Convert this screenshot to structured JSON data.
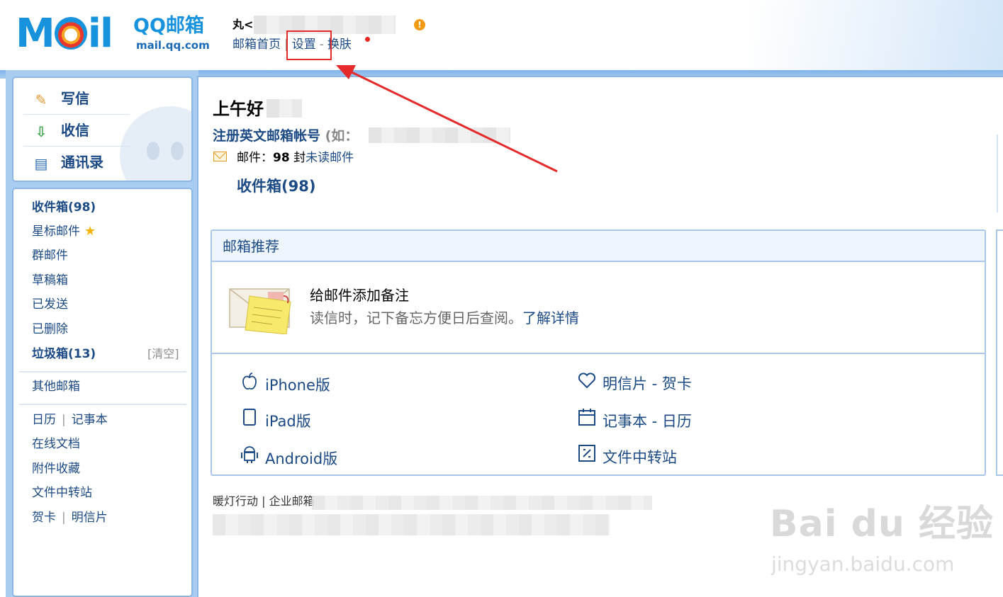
{
  "header": {
    "logo_text": "M",
    "logo_text2": "il",
    "logo_brand": "QQ邮箱",
    "logo_url": "mail.qq.com",
    "user_name_prefix": "丸<",
    "warning_glyph": "!",
    "links": {
      "home": "邮箱首页",
      "settings": "设置",
      "skin": "换肤",
      "sep_bar": "|",
      "sep_dash": "-"
    }
  },
  "quick_actions": [
    {
      "label": "写信",
      "icon": "pencil-icon",
      "glyph": "✎"
    },
    {
      "label": "收信",
      "icon": "inbox-download-icon",
      "glyph": "⇩"
    },
    {
      "label": "通讯录",
      "icon": "contacts-card-icon",
      "glyph": "▤"
    }
  ],
  "nav": {
    "inbox": "收件箱(98)",
    "starred": "星标邮件",
    "star_glyph": "★",
    "group": "群邮件",
    "drafts": "草稿箱",
    "sent": "已发送",
    "deleted": "已删除",
    "spam": "垃圾箱(13)",
    "spam_clear": "[清空]",
    "other": "其他邮箱",
    "calendar": "日历",
    "notebook": "记事本",
    "docs": "在线文档",
    "attachments": "附件收藏",
    "file_transfer": "文件中转站",
    "greeting_card": "贺卡",
    "postcard": "明信片",
    "pipe": "|"
  },
  "main": {
    "greeting": "上午好",
    "register_link": "注册英文邮箱帐号",
    "register_hint": "(如：",
    "mail_label": "邮件：",
    "mail_count": "98",
    "mail_unit": "封",
    "unread_link": "未读邮件",
    "inbox_link": "收件箱(98)"
  },
  "recommend": {
    "title": "邮箱推荐",
    "feature_title": "给邮件添加备注",
    "feature_desc": "读信时，记下备忘方便日后查阅。",
    "feature_link": "了解详情",
    "apps": [
      {
        "label": "iPhone版",
        "icon": "apple-icon",
        "glyph": ""
      },
      {
        "label": "iPad版",
        "icon": "ipad-icon",
        "glyph": "▯"
      },
      {
        "label": "Android版",
        "icon": "android-icon",
        "glyph": "⌂"
      },
      {
        "label": "明信片 - 贺卡",
        "icon": "heart-icon",
        "glyph": "♡"
      },
      {
        "label": "记事本 - 日历",
        "icon": "calendar-icon",
        "glyph": "▭"
      },
      {
        "label": "文件中转站",
        "icon": "file-transfer-icon",
        "glyph": "⧉"
      }
    ]
  },
  "footer": {
    "text": "暖灯行动 | 企业邮箱"
  },
  "watermark": {
    "main": "Bai du 经验",
    "sub": "jingyan.baidu.com"
  },
  "colors": {
    "accent": "#1793de",
    "link": "#1b4a85",
    "highlight": "#e42a2a",
    "frame": "#8cb7e5"
  }
}
